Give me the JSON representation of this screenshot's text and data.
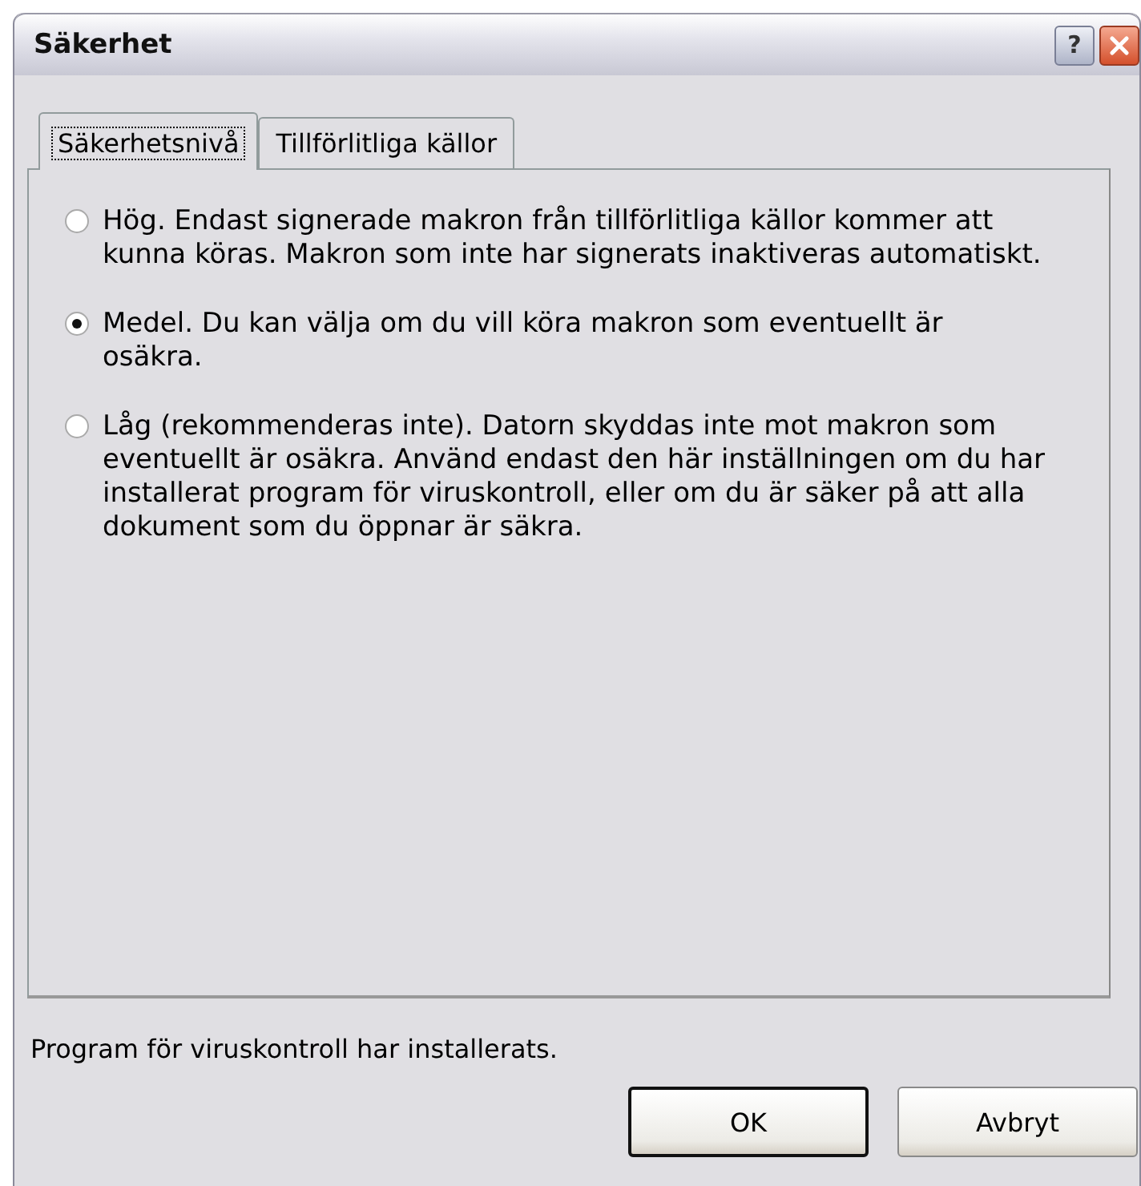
{
  "window": {
    "title": "Säkerhet",
    "buttons": [
      {
        "kind": "help",
        "label": "?"
      },
      {
        "kind": "close"
      }
    ]
  },
  "tabs": [
    {
      "label": "Säkerhetsnivå",
      "selected": true
    },
    {
      "label": "Tillförlitliga källor",
      "selected": false
    }
  ],
  "options": [
    {
      "label": "Hög. Endast signerade makron från tillförlitliga källor kommer att kunna köras. Makron som inte har signerats inaktiveras automatiskt.",
      "selected": false
    },
    {
      "label": "Medel. Du kan välja om du vill köra makron som eventuellt är osäkra.",
      "selected": true
    },
    {
      "label": "Låg (rekommenderas inte). Datorn skyddas inte mot makron som eventuellt är osäkra. Använd endast den här inställningen om du har installerat program för viruskontroll, eller om du är säker på att alla dokument som du öppnar är säkra.",
      "selected": false
    }
  ],
  "status": "Program för viruskontroll har installerats.",
  "buttons": [
    {
      "label": "OK",
      "default": true
    },
    {
      "label": "Avbryt",
      "default": false
    }
  ]
}
